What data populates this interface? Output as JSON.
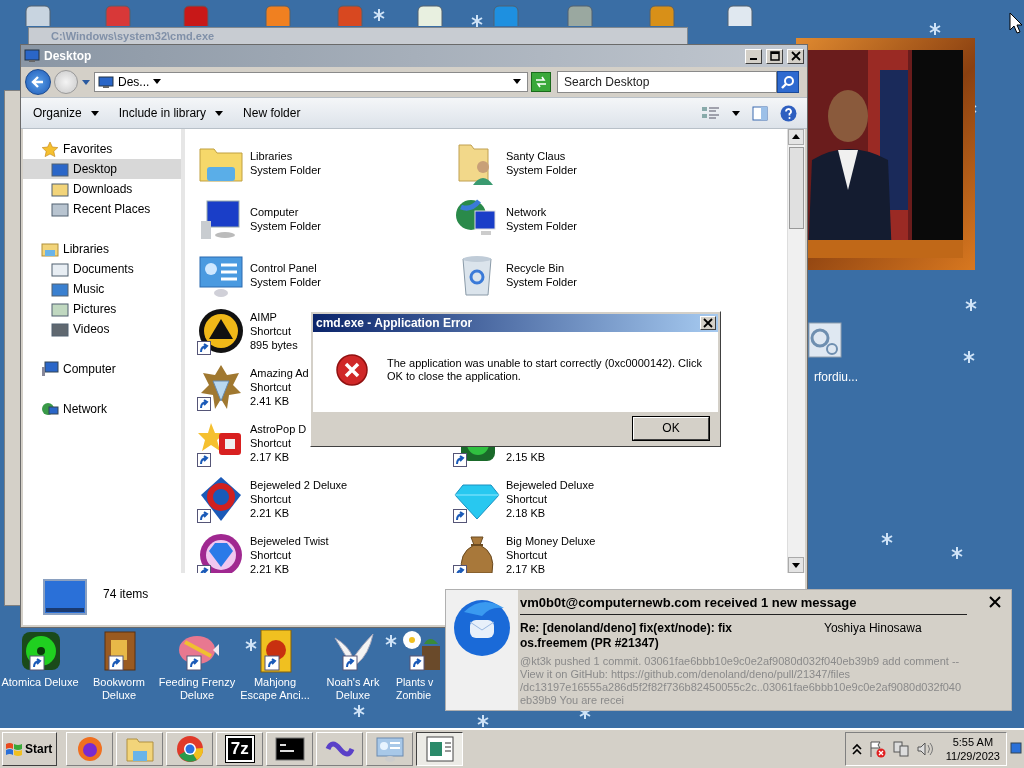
{
  "background_window": {
    "title": "C:\\Windows\\system32\\cmd.exe"
  },
  "desktop": {
    "side_icon": {
      "label": "rfordiu..."
    },
    "bottom_icons": [
      {
        "lines": [
          "Atomica Deluxe"
        ]
      },
      {
        "lines": [
          "Bookworm",
          "Deluxe"
        ]
      },
      {
        "lines": [
          "Feeding Frenzy",
          "Deluxe"
        ]
      },
      {
        "lines": [
          "Mahjong",
          "Escape Anci..."
        ]
      },
      {
        "lines": [
          "Noah's Ark",
          "Deluxe"
        ]
      },
      {
        "lines": [
          "Plants v",
          "Zombie"
        ]
      }
    ]
  },
  "explorer": {
    "title": "Desktop",
    "breadcrumb": "Des...",
    "search": {
      "placeholder": "Search Desktop"
    },
    "toolbar": [
      {
        "label": "Organize",
        "dropdown": true
      },
      {
        "label": "Include in library",
        "dropdown": true
      },
      {
        "label": "New folder",
        "dropdown": false
      }
    ],
    "nav": [
      {
        "label": "Favorites",
        "selected": false,
        "children": [
          {
            "label": "Desktop",
            "selected": true
          },
          {
            "label": "Downloads",
            "selected": false
          },
          {
            "label": "Recent Places",
            "selected": false
          }
        ]
      },
      {
        "label": "Libraries",
        "selected": false,
        "children": [
          {
            "label": "Documents",
            "selected": false
          },
          {
            "label": "Music",
            "selected": false
          },
          {
            "label": "Pictures",
            "selected": false
          },
          {
            "label": "Videos",
            "selected": false
          }
        ]
      },
      {
        "label": "Computer",
        "selected": false
      },
      {
        "label": "Network",
        "selected": false
      }
    ],
    "rows": [
      {
        "cells": [
          {
            "name": "Libraries",
            "type": "System Folder",
            "shortcut": false
          },
          {
            "name": "Santy Claus",
            "type": "System Folder",
            "shortcut": false
          }
        ]
      },
      {
        "cells": [
          {
            "name": "Computer",
            "type": "System Folder",
            "shortcut": false
          },
          {
            "name": "Network",
            "type": "System Folder",
            "shortcut": false
          }
        ]
      },
      {
        "cells": [
          {
            "name": "Control Panel",
            "type": "System Folder",
            "shortcut": false
          },
          {
            "name": "Recycle Bin",
            "type": "System Folder",
            "shortcut": false
          }
        ]
      },
      {
        "cells": [
          {
            "name": "AIMP",
            "type": "Shortcut",
            "size": "895 bytes",
            "shortcut": true
          }
        ]
      },
      {
        "cells": [
          {
            "name": "Amazing Ad",
            "type": "Shortcut",
            "size": "2.41 KB",
            "shortcut": true
          }
        ]
      },
      {
        "cells": [
          {
            "name": "AstroPop D",
            "type": "Shortcut",
            "size": "2.17 KB",
            "shortcut": true
          },
          {
            "size": "2.15 KB",
            "shortcut": true
          }
        ]
      },
      {
        "cells": [
          {
            "name": "Bejeweled 2 Deluxe",
            "type": "Shortcut",
            "size": "2.21 KB",
            "shortcut": true
          },
          {
            "name": "Bejeweled Deluxe",
            "type": "Shortcut",
            "size": "2.18 KB",
            "shortcut": true
          }
        ]
      },
      {
        "cells": [
          {
            "name": "Bejeweled Twist",
            "type": "Shortcut",
            "size": "2.21 KB",
            "shortcut": true
          },
          {
            "name": "Big Money Deluxe",
            "type": "Shortcut",
            "size": "2.17 KB",
            "shortcut": true
          }
        ]
      }
    ],
    "details": {
      "count": "74 items"
    }
  },
  "dialog": {
    "title": "cmd.exe - Application Error",
    "message": [
      "The application was unable to start correctly (0xc0000142). Click",
      "OK to close the application."
    ],
    "button": "OK"
  },
  "notification": {
    "header": "vm0b0t@computernewb.com received 1 new message",
    "subject": [
      "Re: [denoland/deno] fix(ext/node): fix",
      "os.freemem (PR #21347)"
    ],
    "sender": "Yoshiya Hinosawa",
    "body": [
      "@kt3k pushed 1 commit. 03061fae6bbb10e9c0e2af9080d032f040eb39b9 add comment --",
      "View it on GitHub: https://github.com/denoland/deno/pull/21347/files",
      "/dc13197e16555a286d5f2f82f736b82450055c2c..03061fae6bbb10e9c0e2af9080d032f040",
      "eb39b9 You are recei"
    ]
  },
  "taskbar": {
    "start": "Start",
    "tasks": [
      {
        "selected": false
      },
      {
        "selected": false
      },
      {
        "selected": false
      },
      {
        "label": "7z",
        "selected": false
      },
      {
        "selected": false
      },
      {
        "selected": false
      },
      {
        "selected": false
      },
      {
        "selected": true
      }
    ],
    "tray": {
      "time": "5:55 AM",
      "date": "11/29/2023"
    }
  }
}
